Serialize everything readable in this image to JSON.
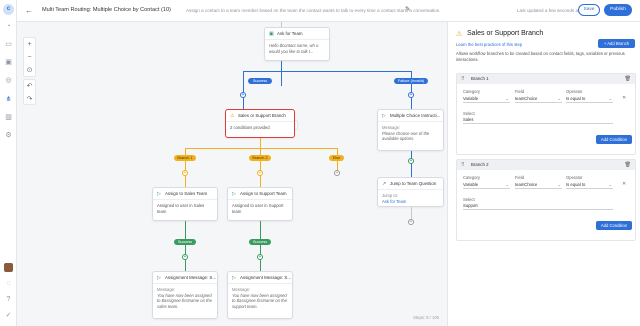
{
  "header": {
    "title": "Multi Team Routing: Multiple Choice by Contact (10)",
    "subtitle": "Assign a contact to a team member based on the team the contact wants to talk to every time a contact starts a conversation.",
    "updated": "Last updated a few seconds ago",
    "save_label": "Save",
    "publish_label": "Publish"
  },
  "canvas": {
    "steps": "Steps: 8 / 100",
    "nodes": {
      "ask_team": {
        "title": "Ask for Team",
        "body": "Hello $contact.name, wh o would you like to talk t..."
      },
      "branch_sel": {
        "title": "Sales or Support Branch",
        "body": "2 conditions provided"
      },
      "multi_choice": {
        "title": "Multiple Choice Instructi...",
        "label": "Message:",
        "body": "Please choose one of the available options."
      },
      "jump": {
        "title": "Jump to Team Question",
        "label": "Jump to:",
        "link": "Ask for Team"
      },
      "assign_sales": {
        "title": "Assign to Sales Team",
        "body": "Assigned to user in Sales team"
      },
      "assign_support": {
        "title": "Assign to Support Team",
        "body": "Assigned to user in Support team"
      },
      "msg_sales": {
        "title": "Assignment Message: S...",
        "label": "Message:",
        "body": "You have now been assigned to $assignee.firstname on the sales team."
      },
      "msg_support": {
        "title": "Assignment Message: S...",
        "label": "Message:",
        "body": "You have now been assigned to $assignee.firstname on the support team."
      }
    },
    "pills": {
      "success": "Success",
      "failure": "Failure (Invalid)",
      "branch1": "Branch 1",
      "branch2": "Branch 2",
      "else": "Else",
      "success_a": "Success",
      "success_b": "Success"
    }
  },
  "panel": {
    "title": "Sales or Support Branch",
    "link": "Learn the best practices of this step",
    "description": "Allows workflow branches to be created based on contact fields, tags, variables or previous interactions.",
    "add_branch": "+ Add Branch",
    "labels": {
      "category": "Category",
      "field": "Field",
      "operator": "Operator",
      "select": "Select"
    },
    "add_condition": "Add Condition",
    "branches": [
      {
        "name": "Branch 1",
        "category": "Variable",
        "field": "teamChoice",
        "operator": "Is equal to",
        "value": "Sales"
      },
      {
        "name": "Branch 2",
        "category": "Variable",
        "field": "teamChoice",
        "operator": "Is equal to",
        "value": "Support"
      }
    ]
  }
}
